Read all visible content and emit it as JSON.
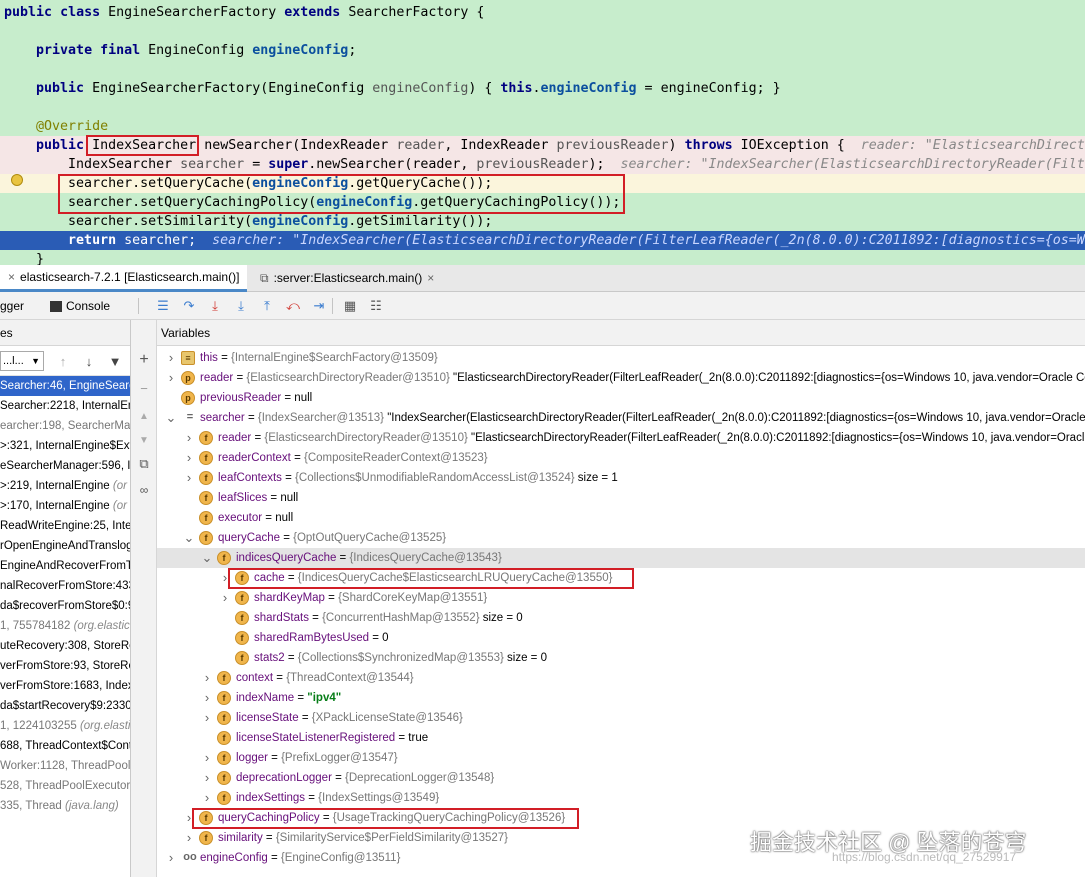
{
  "code": {
    "l1": {
      "kw1": "public",
      "kw2": "class",
      "name": "EngineSearcherFactory",
      "kw3": "extends",
      "base": "SearcherFactory {"
    },
    "l3": {
      "kw1": "private",
      "kw2": "final",
      "type": "EngineConfig",
      "field": "engineConfig",
      "end": ";"
    },
    "l5": {
      "kw1": "public",
      "sig": "EngineSearcherFactory(EngineConfig",
      "param": "engineConfig",
      "mid": ") {",
      "kw2": "this",
      "dot": ".",
      "field": "engineConfig",
      "rest": " = engineConfig; }"
    },
    "l7": {
      "ann": "@Override"
    },
    "l8": {
      "kw1": "public",
      "ret": "IndexSearcher",
      "sig": "newSearcher(IndexReader",
      "p1": "reader",
      "c1": ", IndexReader",
      "p2": "previousReader",
      "c2": ")",
      "kw2": "throws",
      "exc": "IOException {",
      "hint": "reader: \"ElasticsearchDirectoryReader(FilterLeafReader(_2n(8.0.0):C2011892:[diagnostics={os=W"
    },
    "l9": {
      "type": "IndexSearcher",
      "var": "searcher",
      "eq": " =",
      "kw": "super",
      "call": ".newSearcher(reader,",
      "p2": "previousReader",
      "end": ");",
      "hint": "searcher: \"IndexSearcher(ElasticsearchDirectoryReader(FilterLeafReader(_2n(8.0.0):C2011892:["
    },
    "l10": {
      "a": "searcher.setQueryCache(",
      "f": "engineConfig",
      "b": ".getQueryCache());"
    },
    "l11": {
      "a": "searcher.setQueryCachingPolicy(",
      "f": "engineConfig",
      "b": ".getQueryCachingPolicy());"
    },
    "l12": {
      "a": "searcher.setSimilarity(",
      "f": "engineConfig",
      "b": ".getSimilarity());"
    },
    "l13": {
      "kw": "return",
      "a": " searcher;",
      "hint": "searcher: \"IndexSearcher(ElasticsearchDirectoryReader(FilterLeafReader(_2n(8.0.0):C2011892:[diagnostics={os=Wi"
    },
    "l14": {
      "a": "}"
    }
  },
  "tabs": [
    {
      "label": "elasticsearch-7.2.1 [Elasticsearch.main()]"
    },
    {
      "label": ":server:Elasticsearch.main()"
    }
  ],
  "toolbar": {
    "debugger": "gger",
    "console": "Console"
  },
  "frames": {
    "header": "es",
    "thread_select": "...l...",
    "items": [
      {
        "text": "Searcher:46, EngineSearch"
      },
      {
        "text": "Searcher:2218, InternalEng"
      },
      {
        "text": "earcher:198, SearcherMar"
      },
      {
        "text": ">:321, InternalEngine$Ext"
      },
      {
        "text": "eSearcherManager:596, In"
      },
      {
        "text": ">:219, InternalEngine",
        "lib": "(or"
      },
      {
        "text": ">:170, InternalEngine",
        "lib": "(or"
      },
      {
        "text": "ReadWriteEngine:25, Inter"
      },
      {
        "text": "rOpenEngineAndTranslog"
      },
      {
        "text": "EngineAndRecoverFromT"
      },
      {
        "text": "nalRecoverFromStore:433"
      },
      {
        "text": "da$recoverFromStore$0:9"
      },
      {
        "text": "1, 755784182",
        "lib": "(org.elastic"
      },
      {
        "text": "uteRecovery:308, StoreRe"
      },
      {
        "text": "verFromStore:93, StoreRe"
      },
      {
        "text": "verFromStore:1683, Index"
      },
      {
        "text": "da$startRecovery$9:2330"
      },
      {
        "text": "1, 1224103255",
        "lib": "(org.elastic"
      },
      {
        "text": "688, ThreadContext$Conte"
      },
      {
        "text": "Worker:1128, ThreadPoolE"
      },
      {
        "text": "528, ThreadPoolExecutor$"
      },
      {
        "text": "335, Thread",
        "lib": "(java.lang)"
      }
    ]
  },
  "variables": {
    "header": "Variables",
    "rows": [
      {
        "name": "this",
        "type": "{InternalEngine$SearchFactory@13509}",
        "value": ""
      },
      {
        "name": "reader",
        "type": "{ElasticsearchDirectoryReader@13510}",
        "value": "\"ElasticsearchDirectoryReader(FilterLeafReader(_2n(8.0.0):C2011892:[diagnostics={os=Windows 10, java.vendor=Oracle Co"
      },
      {
        "name": "previousReader",
        "type": "",
        "value": "null"
      },
      {
        "name": "searcher",
        "type": "{IndexSearcher@13513}",
        "value": "\"IndexSearcher(ElasticsearchDirectoryReader(FilterLeafReader(_2n(8.0.0):C2011892:[diagnostics={os=Windows 10, java.vendor=Oracle"
      },
      {
        "name": "reader",
        "type": "{ElasticsearchDirectoryReader@13510}",
        "value": "\"ElasticsearchDirectoryReader(FilterLeafReader(_2n(8.0.0):C2011892:[diagnostics={os=Windows 10, java.vendor=Oracl"
      },
      {
        "name": "readerContext",
        "type": "{CompositeReaderContext@13523}",
        "value": ""
      },
      {
        "name": "leafContexts",
        "type": "{Collections$UnmodifiableRandomAccessList@13524}",
        "value": "size = 1"
      },
      {
        "name": "leafSlices",
        "type": "",
        "value": "null"
      },
      {
        "name": "executor",
        "type": "",
        "value": "null"
      },
      {
        "name": "queryCache",
        "type": "{OptOutQueryCache@13525}",
        "value": ""
      },
      {
        "name": "indicesQueryCache",
        "type": "{IndicesQueryCache@13543}",
        "value": ""
      },
      {
        "name": "cache",
        "type": "{IndicesQueryCache$ElasticsearchLRUQueryCache@13550}",
        "value": ""
      },
      {
        "name": "shardKeyMap",
        "type": "{ShardCoreKeyMap@13551}",
        "value": ""
      },
      {
        "name": "shardStats",
        "type": "{ConcurrentHashMap@13552}",
        "value": "size = 0"
      },
      {
        "name": "sharedRamBytesUsed",
        "type": "",
        "value": "0"
      },
      {
        "name": "stats2",
        "type": "{Collections$SynchronizedMap@13553}",
        "value": "size = 0"
      },
      {
        "name": "context",
        "type": "{ThreadContext@13544}",
        "value": ""
      },
      {
        "name": "indexName",
        "type": "",
        "value": "\"ipv4\""
      },
      {
        "name": "licenseState",
        "type": "{XPackLicenseState@13546}",
        "value": ""
      },
      {
        "name": "licenseStateListenerRegistered",
        "type": "",
        "value": "true"
      },
      {
        "name": "logger",
        "type": "{PrefixLogger@13547}",
        "value": ""
      },
      {
        "name": "deprecationLogger",
        "type": "{DeprecationLogger@13548}",
        "value": ""
      },
      {
        "name": "indexSettings",
        "type": "{IndexSettings@13549}",
        "value": ""
      },
      {
        "name": "queryCachingPolicy",
        "type": "{UsageTrackingQueryCachingPolicy@13526}",
        "value": ""
      },
      {
        "name": "similarity",
        "type": "{SimilarityService$PerFieldSimilarity@13527}",
        "value": ""
      },
      {
        "name": "engineConfig",
        "type": "{EngineConfig@13511}",
        "value": ""
      }
    ]
  },
  "watermark": {
    "text": "掘金技术社区 @ 坠落的苍穹",
    "url": "https://blog.csdn.net/qq_27529917"
  },
  "colors": {
    "editor_bg": "#c7edcc",
    "exec_line": "#2a5cb5",
    "selected_frame": "#2f65ca",
    "highlight_box": "#d21e26"
  }
}
